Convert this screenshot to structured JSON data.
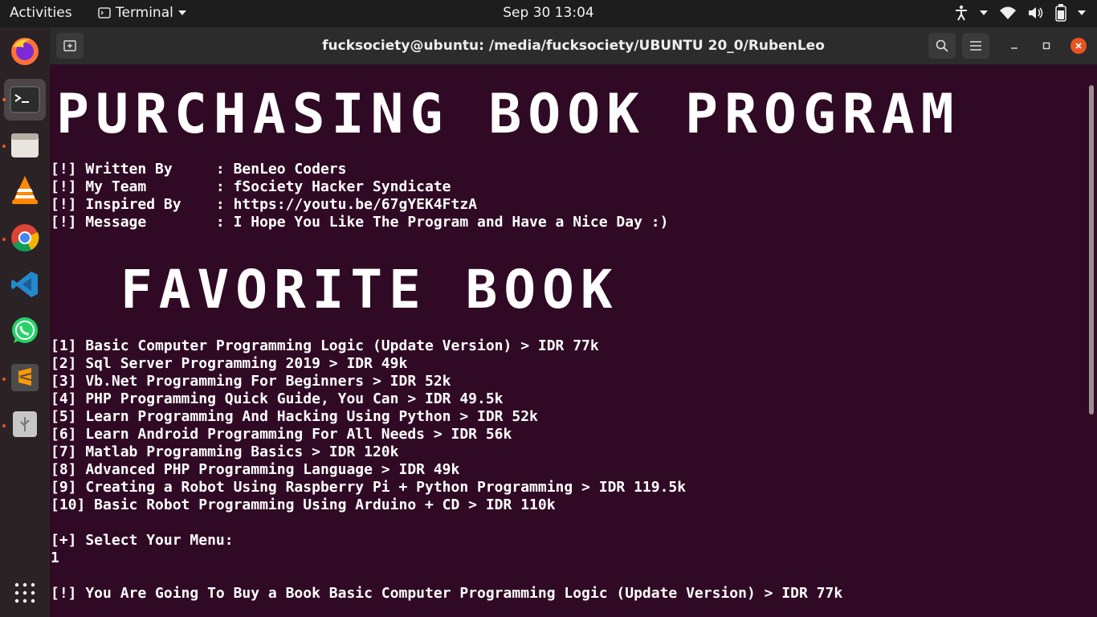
{
  "topbar": {
    "activities": "Activities",
    "app_name": "Terminal",
    "clock": "Sep 30  13:04"
  },
  "dock": {
    "apps": [
      "firefox",
      "terminal",
      "files",
      "vlc",
      "chrome",
      "vscode",
      "whatsapp",
      "sublime-text",
      "usb-drive"
    ],
    "show_apps_icon": "grid-icon"
  },
  "window": {
    "title": "fucksociety@ubuntu: /media/fucksociety/UBUNTU 20_0/RubenLeo"
  },
  "terminal": {
    "banner_title": "PURCHASING BOOK PROGRAM",
    "info": [
      "[!] Written By     : BenLeo Coders",
      "[!] My Team        : fSociety Hacker Syndicate",
      "[!] Inspired By    : https://youtu.be/67gYEK4FtzA",
      "[!] Message        : I Hope You Like The Program and Have a Nice Day :)"
    ],
    "banner_favorite": "FAVORITE BOOK",
    "menu": [
      "[1] Basic Computer Programming Logic (Update Version) > IDR 77k",
      "[2] Sql Server Programming 2019 > IDR 49k",
      "[3] Vb.Net Programming For Beginners > IDR 52k",
      "[4] PHP Programming Quick Guide, You Can > IDR 49.5k",
      "[5] Learn Programming And Hacking Using Python > IDR 52k",
      "[6] Learn Android Programming For All Needs > IDR 56k",
      "[7] Matlab Programming Basics > IDR 120k",
      "[8] Advanced PHP Programming Language > IDR 49k",
      "[9] Creating a Robot Using Raspberry Pi + Python Programming > IDR 119.5k",
      "[10] Basic Robot Programming Using Arduino + CD > IDR 110k"
    ],
    "prompt": "[+] Select Your Menu:",
    "input_value": "1",
    "result": "[!] You Are Going To Buy a Book Basic Computer Programming Logic (Update Version) > IDR 77k"
  },
  "colors": {
    "terminal_bg": "#300a24",
    "topbar_bg": "#1d1d1d",
    "accent": "#e95420"
  }
}
